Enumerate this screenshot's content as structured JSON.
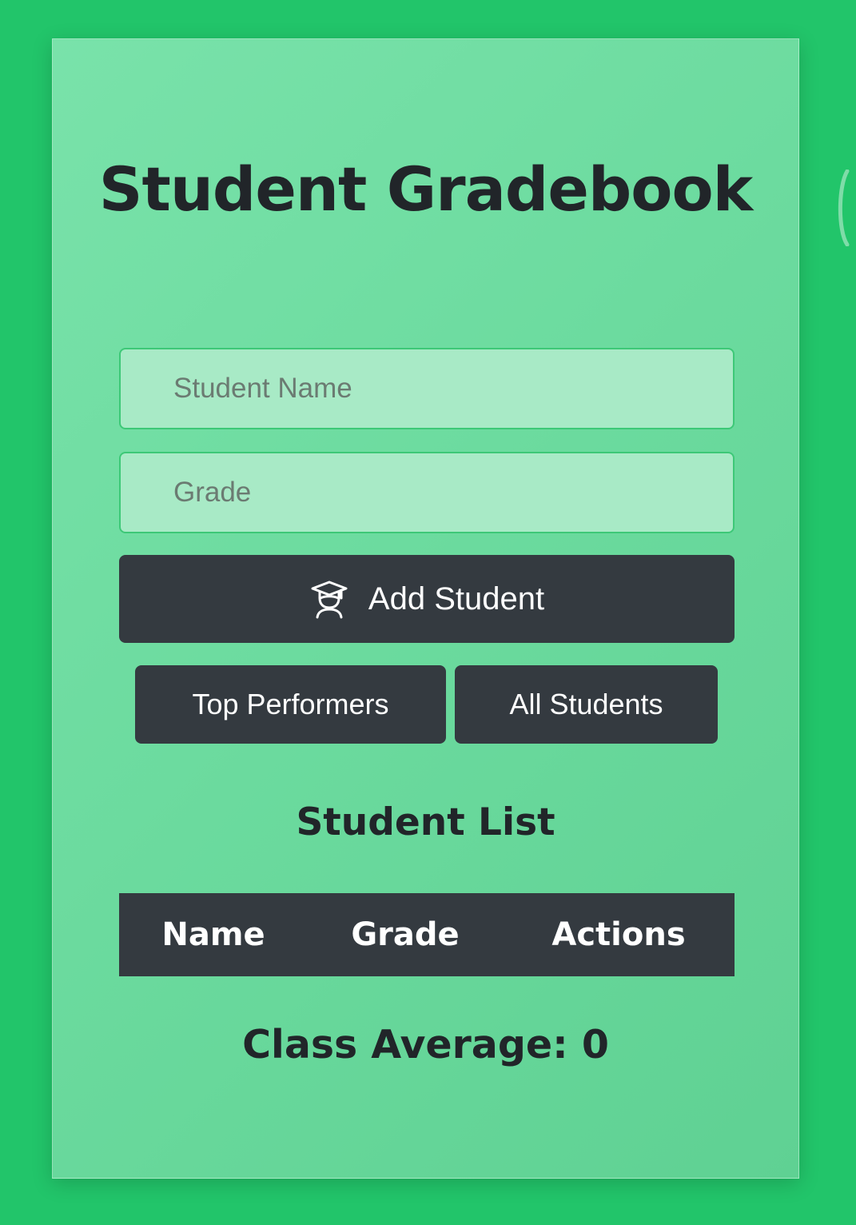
{
  "app": {
    "title": "Student Gradebook"
  },
  "form": {
    "name_placeholder": "Student Name",
    "grade_placeholder": "Grade",
    "add_button_label": "Add Student",
    "add_button_icon": "graduate-icon"
  },
  "filters": {
    "top_performers_label": "Top Performers",
    "all_students_label": "All Students"
  },
  "list": {
    "heading": "Student List",
    "columns": [
      "Name",
      "Grade",
      "Actions"
    ],
    "rows": []
  },
  "summary": {
    "class_average": "Class Average: 0"
  },
  "colors": {
    "page_background": "#22c56a",
    "card_background": "#6cdb9f",
    "input_background": "#a8eac6",
    "input_border": "#3dc877",
    "button_background": "#343a40",
    "text_dark": "#212529"
  }
}
